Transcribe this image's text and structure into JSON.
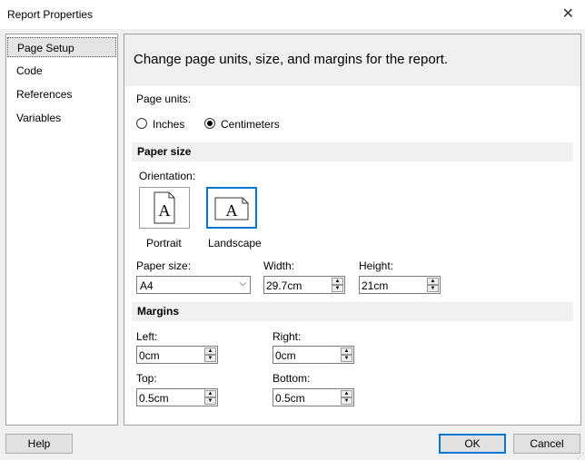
{
  "window": {
    "title": "Report Properties"
  },
  "icons": {
    "close": "close-icon",
    "portrait": "portrait-page-icon",
    "landscape": "landscape-page-icon",
    "dropdown": "chevron-down-icon"
  },
  "sidebar": {
    "items": [
      {
        "label": "Page Setup",
        "selected": true
      },
      {
        "label": "Code"
      },
      {
        "label": "References"
      },
      {
        "label": "Variables"
      }
    ]
  },
  "panel": {
    "header": "Change page units, size, and margins for the report.",
    "page_units": {
      "label": "Page units:",
      "options": [
        {
          "label": "Inches",
          "selected": false
        },
        {
          "label": "Centimeters",
          "selected": true
        }
      ]
    },
    "paper_size_section": "Paper size",
    "orientation": {
      "label": "Orientation:",
      "portrait": "Portrait",
      "landscape": "Landscape",
      "selected": "Landscape",
      "glyph": "A"
    },
    "paper_size": {
      "label": "Paper size:",
      "value": "A4"
    },
    "width": {
      "label": "Width:",
      "value": "29.7cm"
    },
    "height": {
      "label": "Height:",
      "value": "21cm"
    },
    "margins_section": "Margins",
    "left": {
      "label": "Left:",
      "value": "0cm"
    },
    "right": {
      "label": "Right:",
      "value": "0cm"
    },
    "top": {
      "label": "Top:",
      "value": "0.5cm"
    },
    "bottom": {
      "label": "Bottom:",
      "value": "0.5cm"
    }
  },
  "footer": {
    "help": "Help",
    "ok": "OK",
    "cancel": "Cancel"
  },
  "colors": {
    "accent": "#0078d7",
    "section_bg": "#f0f0f0"
  }
}
